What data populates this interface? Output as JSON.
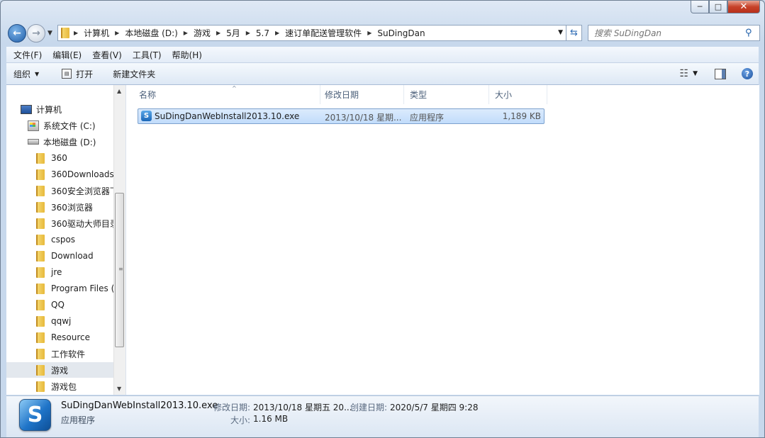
{
  "window": {
    "minimize": "─",
    "maximize": "□",
    "close": "✕"
  },
  "address": {
    "crumbs": [
      "计算机",
      "本地磁盘 (D:)",
      "游戏",
      "5月",
      "5.7",
      "速订单配送管理软件",
      "SuDingDan"
    ]
  },
  "search": {
    "placeholder": "搜索 SuDingDan"
  },
  "menu": [
    "文件(F)",
    "编辑(E)",
    "查看(V)",
    "工具(T)",
    "帮助(H)"
  ],
  "commands": {
    "organize": "组织",
    "open": "打开",
    "new_folder": "新建文件夹"
  },
  "nav": {
    "computer": "计算机",
    "drives": [
      {
        "label": "系统文件 (C:)"
      },
      {
        "label": "本地磁盘 (D:)"
      }
    ],
    "folders": [
      "360",
      "360Downloads",
      "360安全浏览器下",
      "360浏览器",
      "360驱动大师目录",
      "cspos",
      "Download",
      "jre",
      "Program Files (x",
      "QQ",
      "qqwj",
      "Resource",
      "工作软件",
      "游戏",
      "游戏包"
    ],
    "selected_folder": "游戏"
  },
  "columns": {
    "name": "名称",
    "modified": "修改日期",
    "type": "类型",
    "size": "大小"
  },
  "files": [
    {
      "name": "SuDingDanWebInstall2013.10.exe",
      "modified": "2013/10/18 星期...",
      "type": "应用程序",
      "size": "1,189 KB"
    }
  ],
  "details": {
    "filename": "SuDingDanWebInstall2013.10.exe",
    "kind": "应用程序",
    "modified_label": "修改日期:",
    "modified_value": "2013/10/18 星期五 20...",
    "created_label": "创建日期:",
    "created_value": "2020/5/7 星期四 9:28",
    "size_label": "大小:",
    "size_value": "1.16 MB"
  },
  "icons": {
    "back": "back-arrow-icon",
    "forward": "forward-arrow-icon",
    "search": "search-icon",
    "refresh": "refresh-icon",
    "folder": "folder-icon",
    "exe": "application-icon",
    "help": "help-icon"
  }
}
